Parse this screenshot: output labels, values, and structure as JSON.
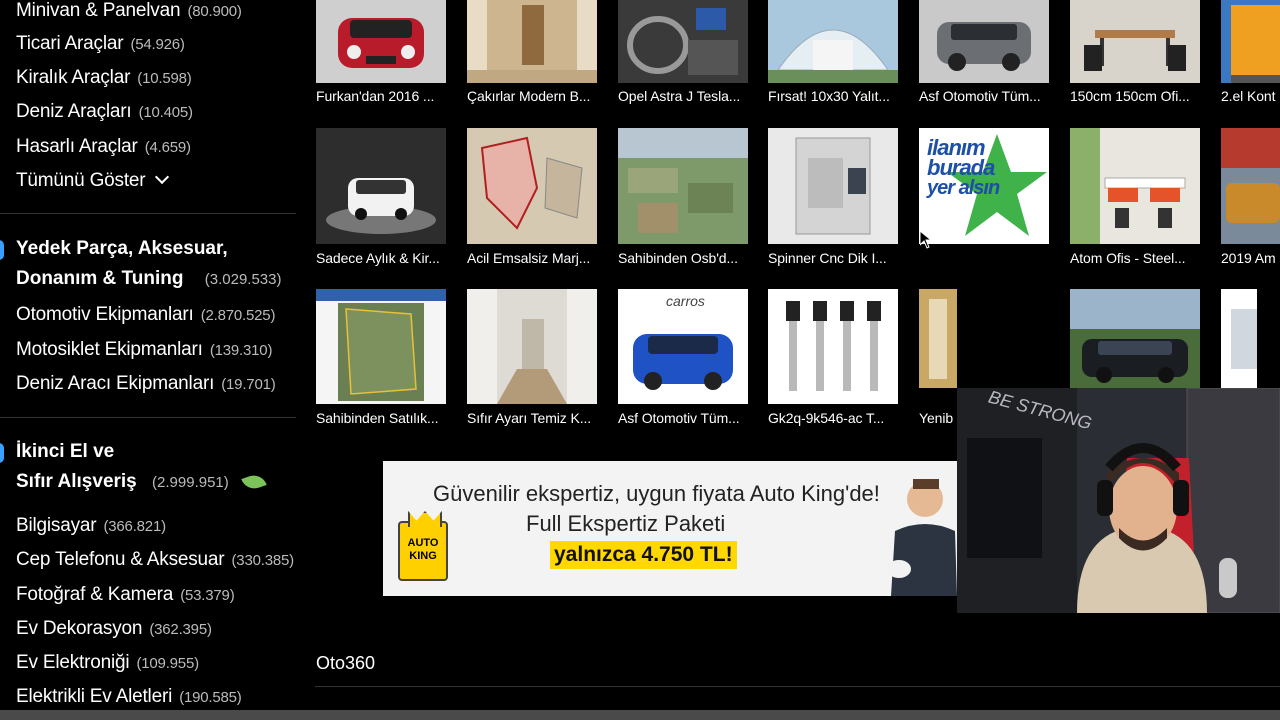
{
  "sidebar": {
    "vehicles": [
      {
        "label": "Minivan & Panelvan",
        "count": "(80.900)"
      },
      {
        "label": "Ticari Araçlar",
        "count": "(54.926)"
      },
      {
        "label": "Kiralık Araçlar",
        "count": "(10.598)"
      },
      {
        "label": "Deniz Araçları",
        "count": "(10.405)"
      },
      {
        "label": "Hasarlı Araçlar",
        "count": "(4.659)"
      }
    ],
    "show_all": "Tümünü Göster",
    "parts_heading": {
      "line1": "Yedek Parça, Aksesuar,",
      "line2": "Donanım & Tuning",
      "count": "(3.029.533)"
    },
    "parts": [
      {
        "label": "Otomotiv Ekipmanları",
        "count": "(2.870.525)"
      },
      {
        "label": "Motosiklet Ekipmanları",
        "count": "(139.310)"
      },
      {
        "label": "Deniz Aracı Ekipmanları",
        "count": "(19.701)"
      }
    ],
    "shopping_heading": {
      "line1": "İkinci El ve",
      "line2": "Sıfır Alışveriş",
      "count": "(2.999.951)"
    },
    "shopping": [
      {
        "label": "Bilgisayar",
        "count": "(366.821)"
      },
      {
        "label": "Cep Telefonu & Aksesuar",
        "count": "(330.385)"
      },
      {
        "label": "Fotoğraf & Kamera",
        "count": "(53.379)"
      },
      {
        "label": "Ev Dekorasyon",
        "count": "(362.395)"
      },
      {
        "label": "Ev Elektroniği",
        "count": "(109.955)"
      },
      {
        "label": "Elektrikli Ev Aletleri",
        "count": "(190.585)"
      }
    ]
  },
  "listings": {
    "row1": [
      "Furkan'dan 2016 ...",
      "Çakırlar Modern B...",
      "Opel Astra J Tesla...",
      "Fırsat! 10x30 Yalıt...",
      "Asf Otomotiv Tüm...",
      "150cm 150cm Ofi...",
      "2.el Kont"
    ],
    "row2": [
      "Sadece Aylık & Kir...",
      "Acil Emsalsiz Marj...",
      "Sahibinden Osb'd...",
      "Spinner Cnc Dik I...",
      "",
      "Atom Ofis - Steel...",
      "2019 Am"
    ],
    "row3": [
      "Sahibinden Satılık...",
      "Sıfır Ayarı Temiz K...",
      "Asf Otomotiv Tüm...",
      "Gk2q-9k546-ac T...",
      "Yenib"
    ]
  },
  "ad_tile": {
    "line1": "ilanım",
    "line2": "burada",
    "line3": "yer alsın"
  },
  "tile_texts": {
    "carros": "carros",
    "cage": "BE STRONG"
  },
  "banner": {
    "line1": "Güvenilir ekspertiz, uygun fiyata Auto King'de!",
    "line2": "Full Ekspertiz Paketi",
    "price": "yalnızca 4.750 TL!",
    "logo": "AUTO KING"
  },
  "section_title": "Oto360"
}
